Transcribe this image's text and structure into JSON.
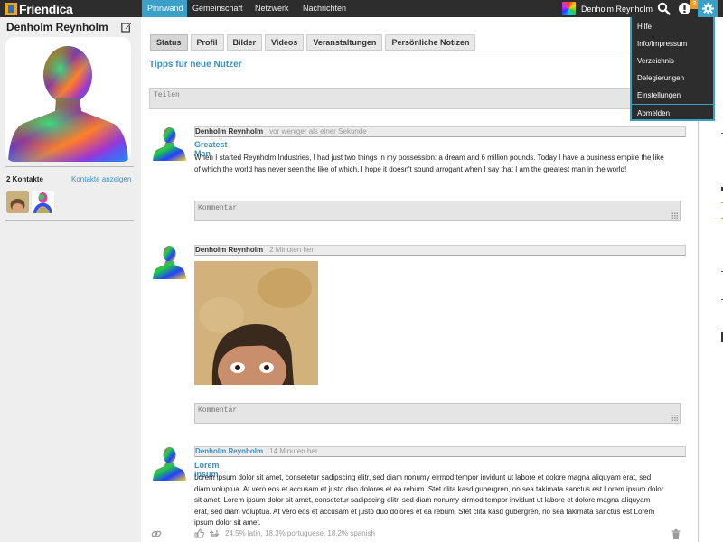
{
  "app": {
    "name": "Friendica"
  },
  "topnav": {
    "items": [
      {
        "label": "Pinnwand",
        "active": true
      },
      {
        "label": "Gemeinschaft",
        "active": false
      },
      {
        "label": "Netzwerk",
        "active": false
      },
      {
        "label": "Nachrichten",
        "active": false
      }
    ],
    "user_name": "Denholm Reynholm",
    "notification_count": "2"
  },
  "dropdown": {
    "items": [
      "Hilfe",
      "Info/Impressum",
      "Verzeichnis",
      "Delegierungen",
      "Einstellungen"
    ],
    "logout": "Abmelden"
  },
  "sidebar": {
    "profile_name": "Denholm Reynholm",
    "contacts_count": "2 Kontakte",
    "contacts_link": "Kontakte anzeigen"
  },
  "tabs": [
    "Status",
    "Profil",
    "Bilder",
    "Videos",
    "Veranstaltungen",
    "Persönliche Notizen"
  ],
  "tips_link": "Tipps für neue Nutzer",
  "share_placeholder": "Teilen",
  "comment_placeholder": "Kommentar",
  "posts": [
    {
      "author": "Denholm Reynholm",
      "time": "vor weniger als einer Sekunde",
      "title": "Greatest Man",
      "body": "When I started Reynholm Industries, I had just two things in my possession: a dream and 6 million pounds. Today I have a business empire the like of which the world has never seen the like of which. I hope it doesn't sound arrogant when I say that I am the greatest man in the world!"
    },
    {
      "author": "Denholm Reynholm",
      "time": "2 Minuten her"
    },
    {
      "author": "Denholm Reynholm",
      "time": "14 Minuten her",
      "title": "Lorem Ipsum",
      "body": "Lorem ipsum dolor sit amet, consetetur sadipscing elitr, sed diam nonumy eirmod tempor invidunt ut labore et dolore magna aliquyam erat, sed diam voluptua. At vero eos et accusam et justo duo dolores et ea rebum. Stet clita kasd gubergren, no sea takimata sanctus est Lorem ipsum dolor sit amet. Lorem ipsum dolor sit amet, consetetur sadipscing elitr, sed diam nonumy eirmod tempor invidunt ut labore et dolore magna aliquyam erat, sed diam voluptua. At vero eos et accusam et justo duo dolores et ea rebum. Stet clita kasd gubergren, no sea takimata sanctus est Lorem ipsum dolor sit amet.",
      "language": "24.5% latin, 18.3% portuguese, 18.2% spanish"
    }
  ],
  "colors": {
    "topbar": "#2d2d2d",
    "accent": "#3aa0c8",
    "link": "#3a8fc0",
    "notification": "#f59a23",
    "sidebar_bg": "#eeeeee"
  },
  "icons": [
    "search-icon",
    "notification-icon",
    "gear-icon",
    "edit-icon",
    "like-icon",
    "share-icon",
    "link-icon",
    "trash-icon"
  ]
}
